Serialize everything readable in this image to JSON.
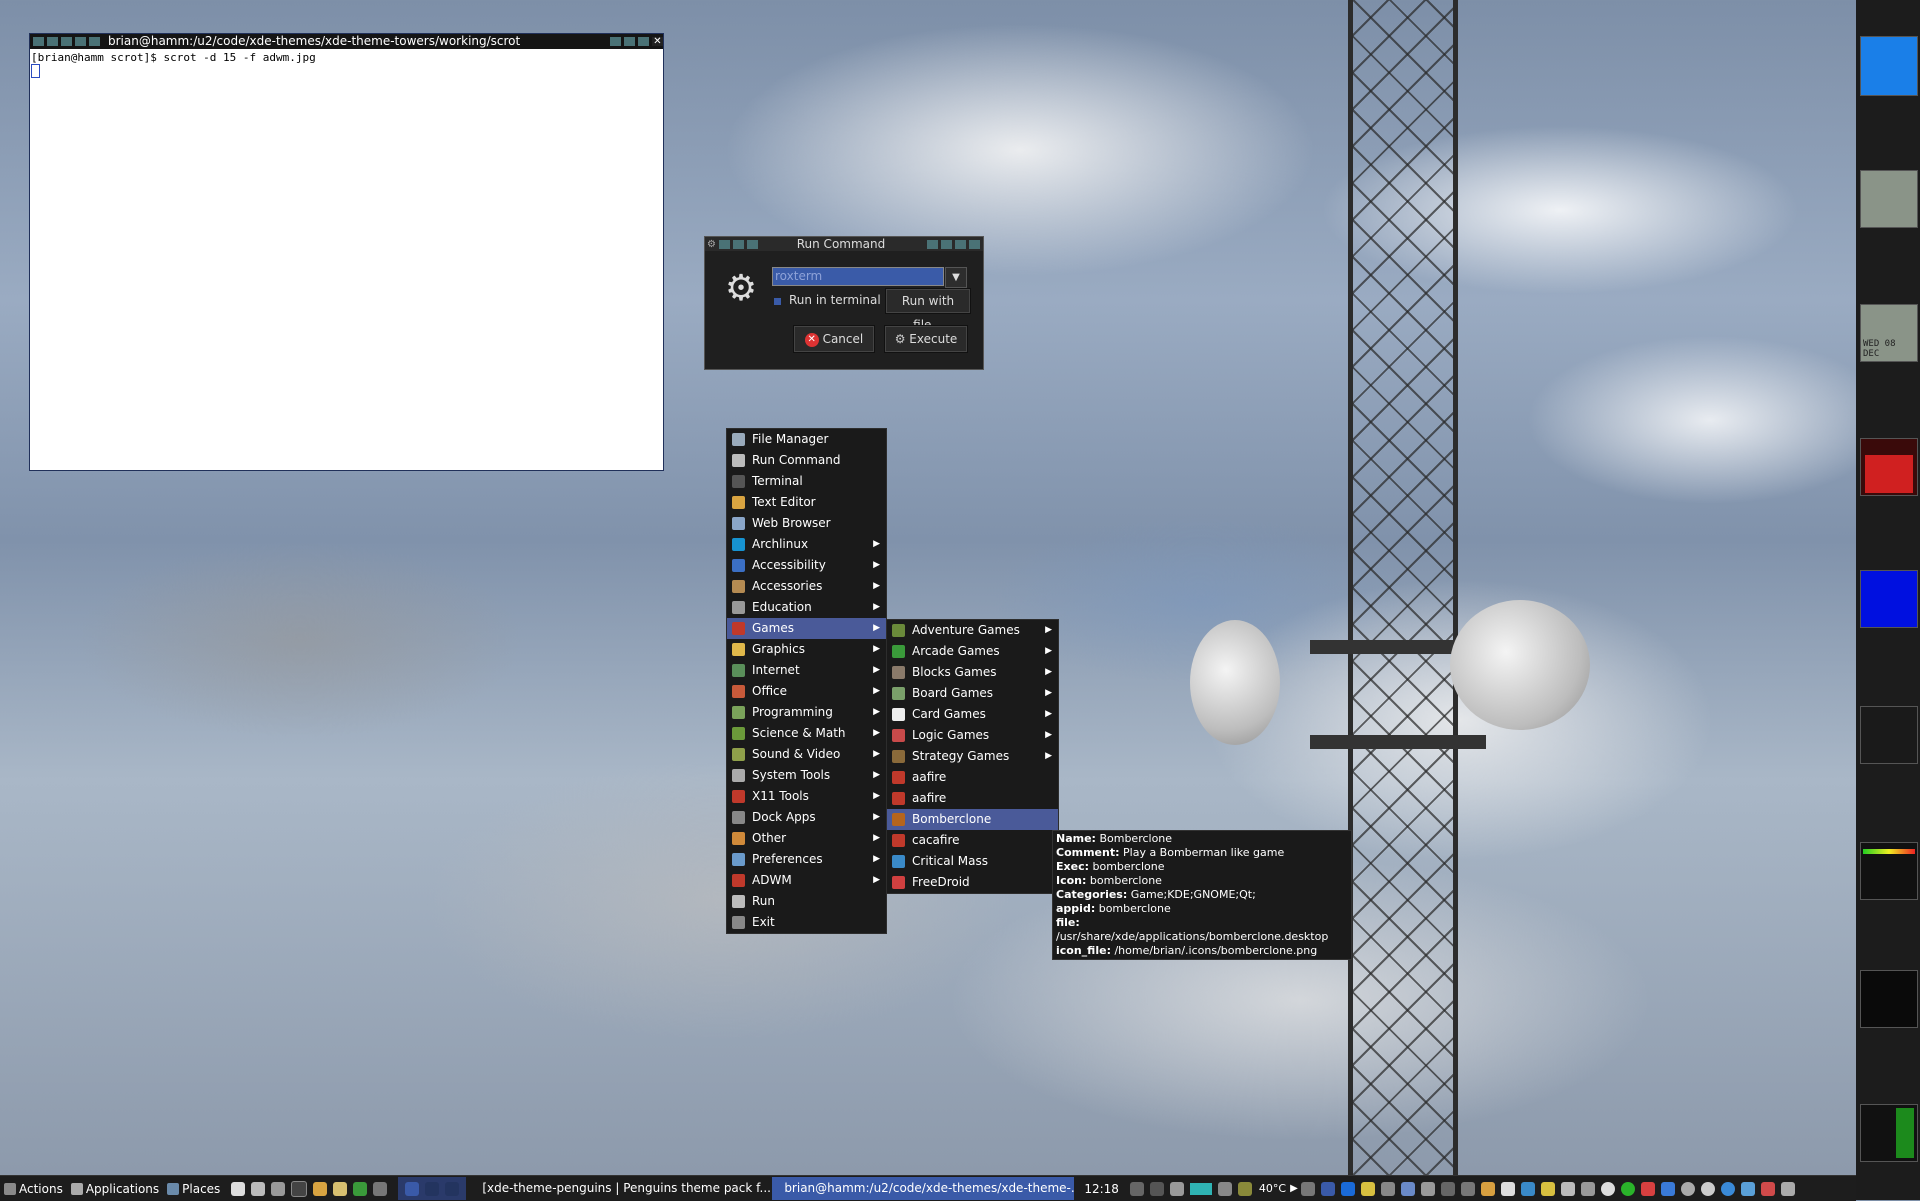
{
  "terminal": {
    "title": "brian@hamm:/u2/code/xde-themes/xde-theme-towers/working/scrot",
    "line": "[brian@hamm scrot]$ scrot -d 15 -f adwm.jpg"
  },
  "run_dialog": {
    "title": "Run Command",
    "command_value": "roxterm",
    "run_in_terminal_label": "Run in terminal",
    "run_with_file_label": "Run with file...",
    "cancel_label": "Cancel",
    "execute_label": "Execute"
  },
  "main_menu": {
    "items": [
      {
        "label": "File Manager",
        "icon": "folder-icon",
        "color": "#9ab",
        "submenu": false
      },
      {
        "label": "Run Command",
        "icon": "gear-icon",
        "color": "#bbb",
        "submenu": false
      },
      {
        "label": "Terminal",
        "icon": "terminal-icon",
        "color": "#555",
        "submenu": false
      },
      {
        "label": "Text Editor",
        "icon": "text-editor-icon",
        "color": "#d9a441",
        "submenu": false
      },
      {
        "label": "Web Browser",
        "icon": "globe-icon",
        "color": "#8aa6c9",
        "submenu": false
      },
      {
        "label": "Archlinux",
        "icon": "archlinux-icon",
        "color": "#1793d1",
        "submenu": true
      },
      {
        "label": "Accessibility",
        "icon": "accessibility-icon",
        "color": "#3b6fc4",
        "submenu": true
      },
      {
        "label": "Accessories",
        "icon": "accessories-icon",
        "color": "#b58b52",
        "submenu": true
      },
      {
        "label": "Education",
        "icon": "education-icon",
        "color": "#999",
        "submenu": true
      },
      {
        "label": "Games",
        "icon": "games-icon",
        "color": "#c0392b",
        "submenu": true,
        "selected": true
      },
      {
        "label": "Graphics",
        "icon": "graphics-icon",
        "color": "#e0b84a",
        "submenu": true
      },
      {
        "label": "Internet",
        "icon": "internet-icon",
        "color": "#5a8f5a",
        "submenu": true
      },
      {
        "label": "Office",
        "icon": "office-icon",
        "color": "#c85a3a",
        "submenu": true
      },
      {
        "label": "Programming",
        "icon": "programming-icon",
        "color": "#7aa35a",
        "submenu": true
      },
      {
        "label": "Science & Math",
        "icon": "science-icon",
        "color": "#6b9a3a",
        "submenu": true
      },
      {
        "label": "Sound & Video",
        "icon": "sound-video-icon",
        "color": "#8fa04a",
        "submenu": true
      },
      {
        "label": "System Tools",
        "icon": "system-tools-icon",
        "color": "#aaa",
        "submenu": true
      },
      {
        "label": "X11 Tools",
        "icon": "x11-icon",
        "color": "#c0392b",
        "submenu": true
      },
      {
        "label": "Dock Apps",
        "icon": "dock-apps-icon",
        "color": "#888",
        "submenu": true
      },
      {
        "label": "Other",
        "icon": "other-icon",
        "color": "#d08a3a",
        "submenu": true
      },
      {
        "label": "Preferences",
        "icon": "preferences-icon",
        "color": "#6a9acb",
        "submenu": true
      },
      {
        "label": "ADWM",
        "icon": "adwm-icon",
        "color": "#c0392b",
        "submenu": true
      },
      {
        "label": "Run",
        "icon": "run-icon",
        "color": "#bbb",
        "submenu": false
      },
      {
        "label": "Exit",
        "icon": "exit-icon",
        "color": "#888",
        "submenu": false
      }
    ]
  },
  "games_menu": {
    "items": [
      {
        "label": "Adventure Games",
        "icon": "adventure-games-icon",
        "color": "#6a8a3a",
        "submenu": true
      },
      {
        "label": "Arcade Games",
        "icon": "arcade-games-icon",
        "color": "#3a9a3a",
        "submenu": true
      },
      {
        "label": "Blocks Games",
        "icon": "blocks-games-icon",
        "color": "#8a7a6a",
        "submenu": true
      },
      {
        "label": "Board Games",
        "icon": "board-games-icon",
        "color": "#7aa06a",
        "submenu": true
      },
      {
        "label": "Card Games",
        "icon": "card-games-icon",
        "color": "#eee",
        "submenu": true
      },
      {
        "label": "Logic Games",
        "icon": "logic-games-icon",
        "color": "#c84a4a",
        "submenu": true
      },
      {
        "label": "Strategy Games",
        "icon": "strategy-games-icon",
        "color": "#8a6a3a",
        "submenu": true
      },
      {
        "label": "aafire",
        "icon": "aafire-icon",
        "color": "#c0392b",
        "submenu": false
      },
      {
        "label": "aafire",
        "icon": "aafire-icon",
        "color": "#c0392b",
        "submenu": false
      },
      {
        "label": "Bomberclone",
        "icon": "bomberclone-icon",
        "color": "#b5651d",
        "submenu": false,
        "selected": true
      },
      {
        "label": "cacafire",
        "icon": "cacafire-icon",
        "color": "#c0392b",
        "submenu": false
      },
      {
        "label": "Critical Mass",
        "icon": "critical-mass-icon",
        "color": "#3a8ac8",
        "submenu": false
      },
      {
        "label": "FreeDroid",
        "icon": "freedroid-icon",
        "color": "#d04040",
        "submenu": false
      }
    ]
  },
  "tooltip": {
    "lines": [
      {
        "key": "Name:",
        "value": " Bomberclone"
      },
      {
        "key": "Comment:",
        "value": " Play a Bomberman like game"
      },
      {
        "key": "Exec:",
        "value": " bomberclone"
      },
      {
        "key": "Icon:",
        "value": " bomberclone"
      },
      {
        "key": "Categories:",
        "value": " Game;KDE;GNOME;Qt;"
      },
      {
        "key": "appid:",
        "value": " bomberclone"
      },
      {
        "key": "file:",
        "value": " /usr/share/xde/applications/bomberclone.desktop"
      },
      {
        "key": "icon_file:",
        "value": " /home/brian/.icons/bomberclone.png"
      }
    ]
  },
  "taskbar": {
    "actions_label": "Actions",
    "applications_label": "Applications",
    "places_label": "Places",
    "task1": "[xde-theme-penguins | Penguins theme pack f...",
    "task2": "brian@hamm:/u2/code/xde-themes/xde-theme-...",
    "clock": "12:18",
    "temperature": "40°C"
  },
  "dock": {
    "clock_date": "WED 08 DEC"
  }
}
